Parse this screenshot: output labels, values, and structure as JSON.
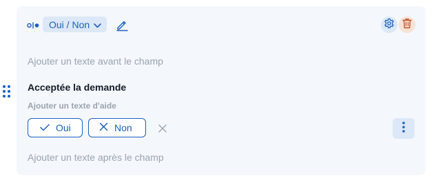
{
  "toolbar": {
    "type_icon": "toggle-choice-icon",
    "type_select_value": "Oui / Non",
    "type_select_icon": "chevron-down-icon",
    "edit_icon": "pencil-icon",
    "settings_icon": "gear-icon",
    "delete_icon": "trash-icon"
  },
  "field": {
    "text_before_placeholder": "Ajouter un texte avant le champ",
    "label": "Acceptée la demande",
    "help_placeholder": "Ajouter un texte d'aide",
    "options": [
      {
        "label": "Oui",
        "icon": "check-icon"
      },
      {
        "label": "Non",
        "icon": "x-icon"
      }
    ],
    "clear_icon": "close-icon",
    "more_icon": "more-vertical-icon",
    "text_after_placeholder": "Ajouter un texte après le champ"
  },
  "drag_handle_icon": "drag-handle-icon",
  "colors": {
    "accent": "#1d5fc0",
    "card_background": "#f4f7fc",
    "chip_background": "#dce7f7",
    "delete_background": "#f7e2d6",
    "delete_icon": "#c0532a",
    "placeholder": "#9aa3ad",
    "label": "#141c28"
  }
}
